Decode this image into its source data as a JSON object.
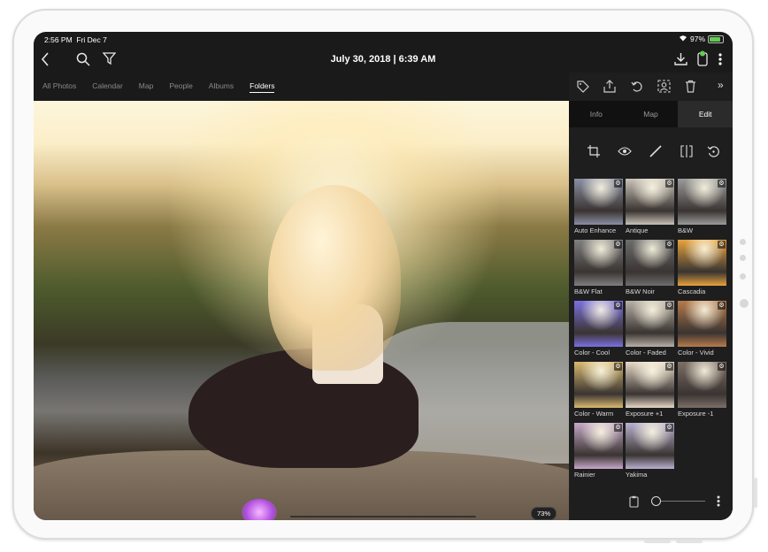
{
  "status_bar": {
    "time": "2:56 PM",
    "date": "Fri Dec 7",
    "battery": "97%"
  },
  "toolbar": {
    "title": "July 30, 2018 | 6:39 AM"
  },
  "tabs": [
    {
      "label": "All Photos",
      "active": false
    },
    {
      "label": "Calendar",
      "active": false
    },
    {
      "label": "Map",
      "active": false
    },
    {
      "label": "People",
      "active": false
    },
    {
      "label": "Albums",
      "active": false
    },
    {
      "label": "Folders",
      "active": true
    }
  ],
  "photo": {
    "zoom": "73%"
  },
  "panel": {
    "segments": [
      {
        "label": "Info",
        "active": false
      },
      {
        "label": "Map",
        "active": false
      },
      {
        "label": "Edit",
        "active": true
      }
    ],
    "expand_label": "»",
    "filters": [
      {
        "label": "Auto Enhance",
        "tint": "#8a8fa4"
      },
      {
        "label": "Antique",
        "tint": "#c8c2b8"
      },
      {
        "label": "B&W",
        "tint": "#9b9b9b"
      },
      {
        "label": "B&W Flat",
        "tint": "#7f7f7f"
      },
      {
        "label": "B&W Noir",
        "tint": "#6d6d6d"
      },
      {
        "label": "Cascadia",
        "tint": "#e7a23c"
      },
      {
        "label": "Color - Cool",
        "tint": "#7b70e0"
      },
      {
        "label": "Color - Faded",
        "tint": "#b7b0a6"
      },
      {
        "label": "Color - Vivid",
        "tint": "#b77a4a"
      },
      {
        "label": "Color - Warm",
        "tint": "#d9b96e"
      },
      {
        "label": "Exposure +1",
        "tint": "#e6d8c6"
      },
      {
        "label": "Exposure -1",
        "tint": "#7c6f66"
      },
      {
        "label": "Rainier",
        "tint": "#c6a8c9"
      },
      {
        "label": "Yakima",
        "tint": "#b9b0d0"
      }
    ]
  },
  "colors": {
    "accent": "#5fce4f",
    "panel_bg": "#1e1e1e",
    "screen_bg": "#1a1a1a"
  }
}
